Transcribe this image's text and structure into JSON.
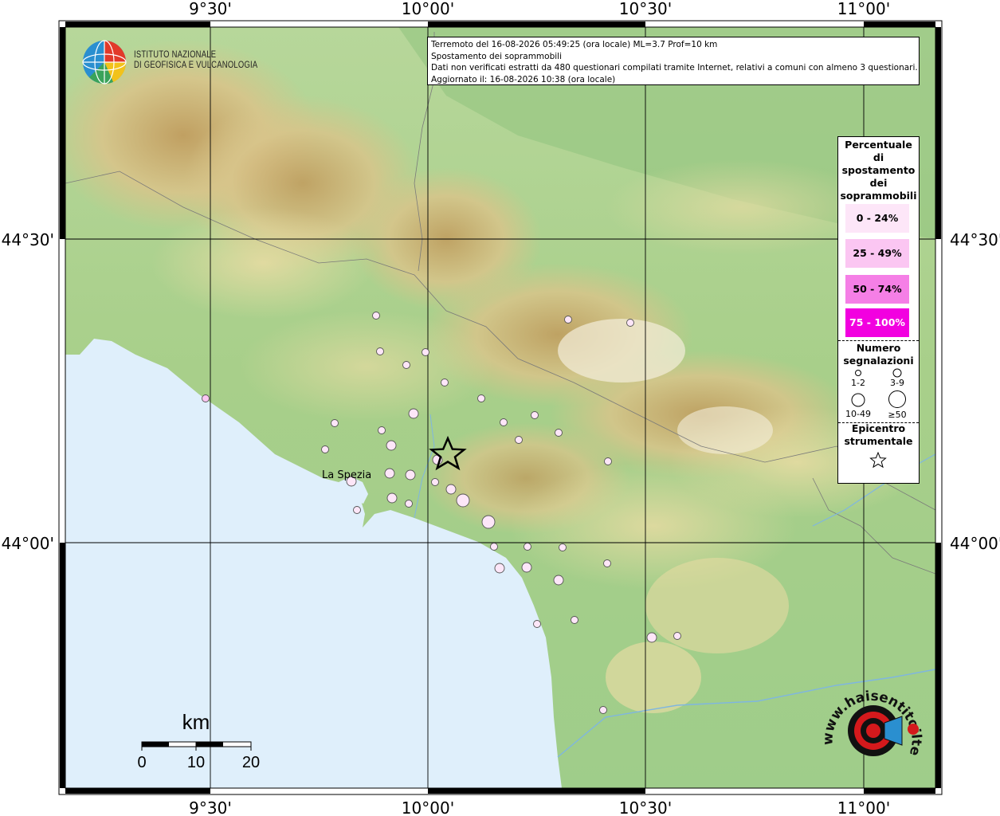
{
  "info": {
    "line1": "Terremoto del 16-08-2026 05:49:25 (ora locale) ML=3.7 Prof=10 km",
    "line2": "Spostamento dei soprammobili",
    "line3": "Dati non verificati estratti da 480 questionari compilati tramite Internet, relativi a comuni con almeno 3 questionari.",
    "line4": "Aggiornato il: 16-08-2026 10:38 (ora locale)"
  },
  "ingv": {
    "line1": "ISTITUTO NAZIONALE",
    "line2": "DI GEOFISICA E VULCANOLOGIA"
  },
  "axes": {
    "lon_top": [
      "9°30'",
      "10°00'",
      "10°30'",
      "11°00'"
    ],
    "lon_bottom": [
      "9°30'",
      "10°00'",
      "10°30'",
      "11°00'"
    ],
    "lat_left": [
      "44°30'",
      "44°00'"
    ],
    "lat_right": [
      "44°30'",
      "44°00'"
    ]
  },
  "city": {
    "name": "La Spezia"
  },
  "scalebar": {
    "unit": "km",
    "ticks": [
      "0",
      "10",
      "20"
    ]
  },
  "legend": {
    "title": [
      "Percentuale",
      "di",
      "spostamento",
      "dei",
      "soprammobili"
    ],
    "classes": [
      {
        "label": "0 - 24%",
        "color": "#fde6f8"
      },
      {
        "label": "25 - 49%",
        "color": "#fbc6f2"
      },
      {
        "label": "50 - 74%",
        "color": "#f57fe6"
      },
      {
        "label": "75 - 100%",
        "color": "#f200e0"
      }
    ],
    "count_title": [
      "Numero",
      "segnalazioni"
    ],
    "sizes": [
      "1-2",
      "3-9",
      "10-49",
      "≥50"
    ],
    "epicenter_title": [
      "Epicentro",
      "strumentale"
    ]
  },
  "watermark": {
    "text": "www.haisentitoilterremoto.it"
  },
  "colors": {
    "sea": "#dfeffb",
    "marker_fill": "#fde6f8",
    "frame": "#000000"
  }
}
